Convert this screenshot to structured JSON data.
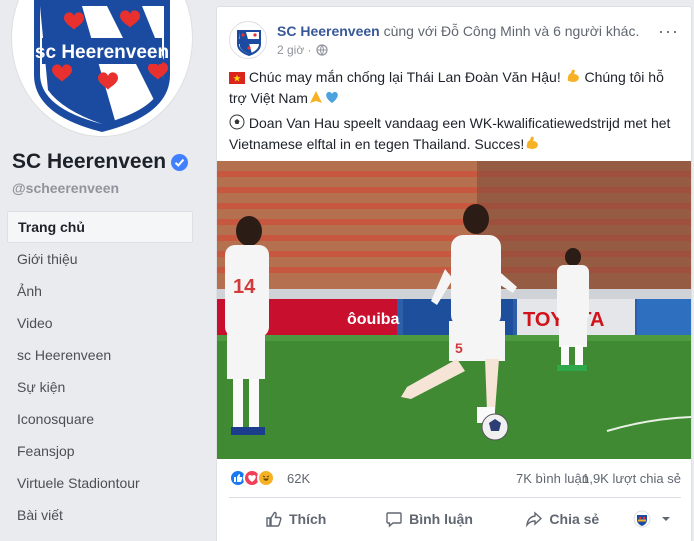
{
  "sidebar": {
    "page_name": "SC Heerenveen",
    "handle": "@scheerenveen",
    "logo_text": "sc Heerenveen",
    "items": [
      {
        "label": "Trang chủ",
        "active": true
      },
      {
        "label": "Giới thiệu"
      },
      {
        "label": "Ảnh"
      },
      {
        "label": "Video"
      },
      {
        "label": "sc Heerenveen"
      },
      {
        "label": "Sự kiện"
      },
      {
        "label": "Iconosquare"
      },
      {
        "label": "Feansjop"
      },
      {
        "label": "Virtuele Stadiontour"
      },
      {
        "label": "Bài viết"
      }
    ]
  },
  "post": {
    "author": "SC Heerenveen",
    "with_text": " cùng với Đỗ Công Minh và 6 người khác.",
    "time": "2 giờ ·",
    "more": "···",
    "line1_a": " Chúc may mắn chống lại Thái Lan Đoàn Văn Hậu! ",
    "line1_b": " Chúng tôi hỗ trợ Việt Nam",
    "line2_a": " Doan Van Hau speelt vandaag een WK-kwalificatiewedstrijd met het Vietnamese elftal in en tegen Thailand. Succes!",
    "photo_ad_1": "ôouiba",
    "photo_ad_2": "TOYOTA",
    "jersey_1": "14",
    "jersey_2": "5",
    "reaction_count": "62K",
    "comments": "7K bình luận",
    "shares": "1,9K lượt chia sẻ",
    "actions": {
      "like": "Thích",
      "comment": "Bình luận",
      "share": "Chia sẻ"
    }
  },
  "colors": {
    "link": "#385898",
    "like_blue": "#1877f2",
    "love_red": "#f33e58",
    "haha_yellow": "#f7b125",
    "verified_blue": "#4080ff"
  }
}
